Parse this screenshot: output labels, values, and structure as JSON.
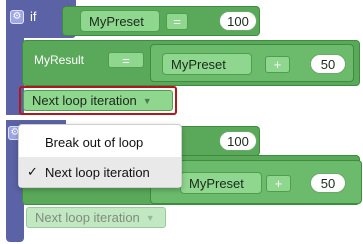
{
  "if_block_1": {
    "keyword": "if",
    "condition": {
      "variable": "MyPreset",
      "operator": "=",
      "value": "100"
    },
    "set_statement": {
      "variable": "MyResult",
      "operator": "=",
      "expression": {
        "variable": "MyPreset",
        "operator": "+",
        "value": "50"
      }
    },
    "loop_block": "Next loop iteration"
  },
  "if_block_2": {
    "condition": {
      "value": "100"
    },
    "expression": {
      "variable": "MyPreset",
      "operator": "+",
      "value": "50"
    },
    "loop_block": "Next loop iteration"
  },
  "dropdown": {
    "options": [
      "Break out of loop",
      "Next loop iteration"
    ],
    "selected": "Next loop iteration",
    "check_mark": "✓"
  }
}
